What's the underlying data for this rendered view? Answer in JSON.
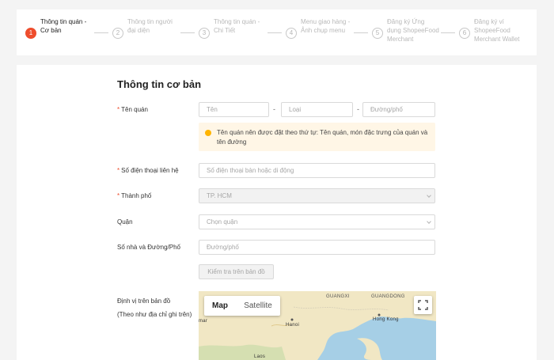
{
  "stepper": {
    "steps": [
      {
        "num": "1",
        "line1": "Thông tin quán -",
        "line2": "Cơ bản",
        "line3": ""
      },
      {
        "num": "2",
        "line1": "Thông tin người",
        "line2": "đại diện",
        "line3": ""
      },
      {
        "num": "3",
        "line1": "Thông tin quán -",
        "line2": "Chi Tiết",
        "line3": ""
      },
      {
        "num": "4",
        "line1": "Menu giao hàng -",
        "line2": "Ảnh chụp menu",
        "line3": ""
      },
      {
        "num": "5",
        "line1": "Đăng ký Ứng",
        "line2": "dụng ShopeeFood",
        "line3": "Merchant"
      },
      {
        "num": "6",
        "line1": "Đăng ký ví",
        "line2": "ShopeeFood",
        "line3": "Merchant Wallet"
      }
    ]
  },
  "form": {
    "title": "Thông tin cơ bản",
    "required_mark": "*",
    "store_name": {
      "label": "Tên quán",
      "ten_placeholder": "Tên",
      "loai_placeholder": "Loại",
      "duong_placeholder": "Đường/phố",
      "separator": "-"
    },
    "note": {
      "line1": "Tên quán nên được đặt theo thứ tự: Tên quán, món đặc trưng của quán và",
      "line2": "tên đường"
    },
    "phone": {
      "label": "Số điện thoại liên hệ",
      "placeholder": "Số điện thoại bàn hoặc di động"
    },
    "city": {
      "label": "Thành phố",
      "value": "TP. HCM"
    },
    "district": {
      "label": "Quận",
      "placeholder": "Chọn quận"
    },
    "address": {
      "label": "Số nhà và Đường/Phố",
      "placeholder": "Đường/phố"
    },
    "check_button": "Kiểm tra trên bản đồ",
    "map_section": {
      "label": "Định vị trên bản đồ",
      "sublabel": "(Theo như địa chỉ ghi trên)"
    }
  },
  "map": {
    "tab_map": "Map",
    "tab_satellite": "Satellite",
    "labels": {
      "guangxi": "GUANGXI",
      "guangdong": "GUANGDONG",
      "hanoi": "Hanoi",
      "hongkong": "Hong Kong",
      "mar": "mar",
      "laos": "Laos"
    },
    "colors": {
      "land": "#f1e7c4",
      "water": "#a6cfe6"
    }
  },
  "colors": {
    "accent": "#ee4d2d",
    "note_bg": "#fff6e6",
    "note_icon": "#ffb400"
  }
}
